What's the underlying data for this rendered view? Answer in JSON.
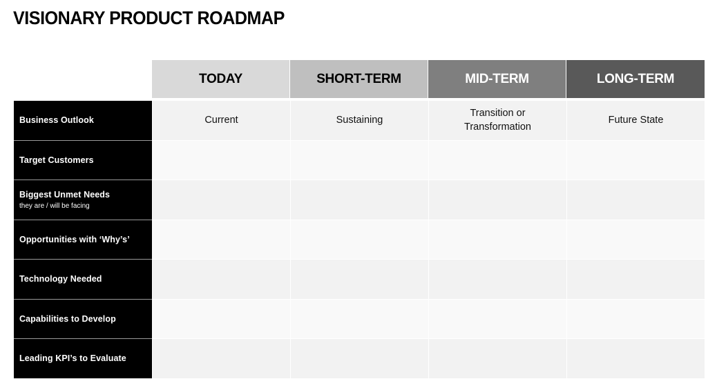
{
  "title": "VISIONARY PRODUCT ROADMAP",
  "columns": [
    {
      "label": "TODAY",
      "bg": "#d9d9d9",
      "fg": "#000000"
    },
    {
      "label": "SHORT-TERM",
      "bg": "#bfbfbf",
      "fg": "#000000"
    },
    {
      "label": "MID-TERM",
      "bg": "#7f7f7f",
      "fg": "#ffffff"
    },
    {
      "label": "LONG-TERM",
      "bg": "#595959",
      "fg": "#ffffff"
    }
  ],
  "rows": [
    {
      "label": "Business Outlook",
      "sublabel": "",
      "cells": [
        "Current",
        "Sustaining",
        "Transition or\nTransformation",
        "Future State"
      ]
    },
    {
      "label": "Target Customers",
      "sublabel": "",
      "cells": [
        "",
        "",
        "",
        ""
      ]
    },
    {
      "label": "Biggest Unmet Needs",
      "sublabel": "they are / will be facing",
      "cells": [
        "",
        "",
        "",
        ""
      ]
    },
    {
      "label": "Opportunities with ‘Why’s’",
      "sublabel": "",
      "cells": [
        "",
        "",
        "",
        ""
      ]
    },
    {
      "label": "Technology Needed",
      "sublabel": "",
      "cells": [
        "",
        "",
        "",
        ""
      ]
    },
    {
      "label": "Capabilities to Develop",
      "sublabel": "",
      "cells": [
        "",
        "",
        "",
        ""
      ]
    },
    {
      "label": "Leading KPI’s to Evaluate",
      "sublabel": "",
      "cells": [
        "",
        "",
        "",
        ""
      ]
    }
  ]
}
